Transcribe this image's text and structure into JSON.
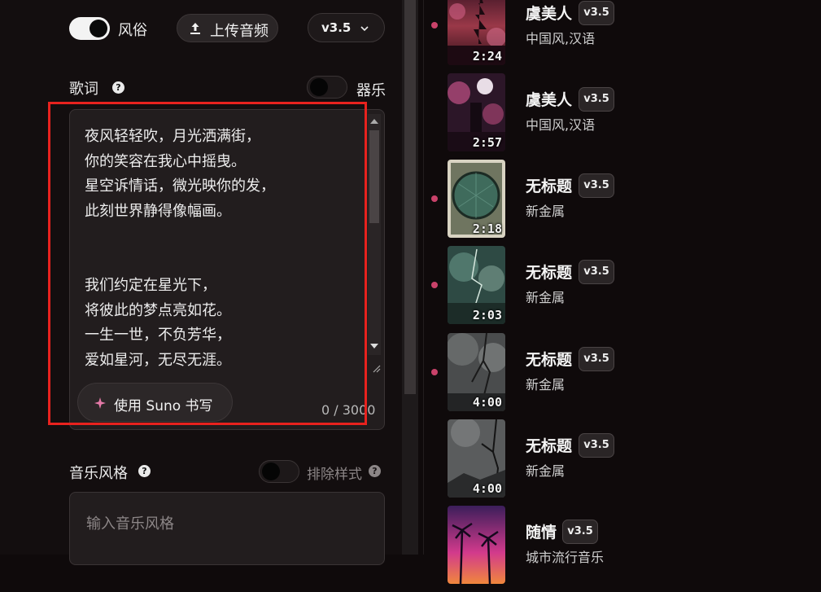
{
  "controls": {
    "custom_label": "风俗",
    "upload_label": "上传音频",
    "version": "v3.5"
  },
  "lyrics": {
    "label": "歌词",
    "instrumental_label": "器乐",
    "text": "夜风轻轻吹，月光洒满街，\n你的笑容在我心中摇曳。\n星空诉情话，微光映你的发，\n此刻世界静得像幅画。\n\n\n我们约定在星光下，\n将彼此的梦点亮如花。\n一生一世，不负芳华，\n爱如星河，无尽无涯。",
    "write_button": "使用 Suno 书写",
    "counter": "0 / 3000"
  },
  "style": {
    "label": "音乐风格",
    "exclude_label": "排除样式",
    "placeholder": "输入音乐风格"
  },
  "songs": [
    {
      "title": "虞美人",
      "version": "v3.5",
      "style": "中国风,汉语",
      "duration": "2:24",
      "dot": true,
      "palette": "pagoda-dusk"
    },
    {
      "title": "虞美人",
      "version": "v3.5",
      "style": "中国风,汉语",
      "duration": "2:57",
      "dot": false,
      "palette": "blossom-moon"
    },
    {
      "title": "无标题",
      "version": "v3.5",
      "style": "新金属",
      "duration": "2:18",
      "dot": true,
      "palette": "green-orb"
    },
    {
      "title": "无标题",
      "version": "v3.5",
      "style": "新金属",
      "duration": "2:03",
      "dot": true,
      "palette": "green-storm"
    },
    {
      "title": "无标题",
      "version": "v3.5",
      "style": "新金属",
      "duration": "4:00",
      "dot": true,
      "palette": "grey-storm"
    },
    {
      "title": "无标题",
      "version": "v3.5",
      "style": "新金属",
      "duration": "4:00",
      "dot": false,
      "palette": "grey-tree"
    },
    {
      "title": "随情",
      "version": "v3.5",
      "style": "城市流行音乐",
      "duration": "",
      "dot": false,
      "palette": "synthwave-palms"
    }
  ],
  "colors": {
    "accent_dot": "#c9426a",
    "highlight_box": "#e8221e",
    "background": "#0f0a0b"
  },
  "icons": {
    "upload": "upload-icon",
    "chevron": "chevron-down-icon",
    "help": "help-icon",
    "sparkle": "sparkle-icon"
  }
}
